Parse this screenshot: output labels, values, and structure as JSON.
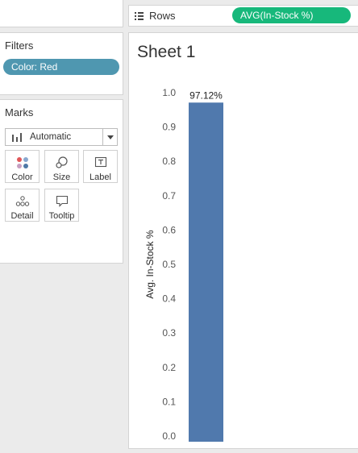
{
  "shelf": {
    "rows_label": "Rows",
    "rows_pill": "AVG(In-Stock %)"
  },
  "filters": {
    "title": "Filters",
    "items": [
      "Color: Red"
    ]
  },
  "marks": {
    "title": "Marks",
    "type": "Automatic",
    "buttons": [
      "Color",
      "Size",
      "Label",
      "Detail",
      "Tooltip"
    ]
  },
  "sheet": {
    "title": "Sheet 1"
  },
  "colors": {
    "bar": "#5079ad",
    "filter_pill": "#4f97b0",
    "rows_pill": "#17b87b"
  },
  "chart_data": {
    "type": "bar",
    "categories": [
      ""
    ],
    "values": [
      0.9712
    ],
    "data_labels": [
      "97.12%"
    ],
    "title": "",
    "xlabel": "",
    "ylabel": "Avg. In-Stock %",
    "ylim": [
      0,
      1
    ],
    "yticks": [
      "0.0",
      "0.1",
      "0.2",
      "0.3",
      "0.4",
      "0.5",
      "0.6",
      "0.7",
      "0.8",
      "0.9",
      "1.0"
    ],
    "grid": false
  }
}
